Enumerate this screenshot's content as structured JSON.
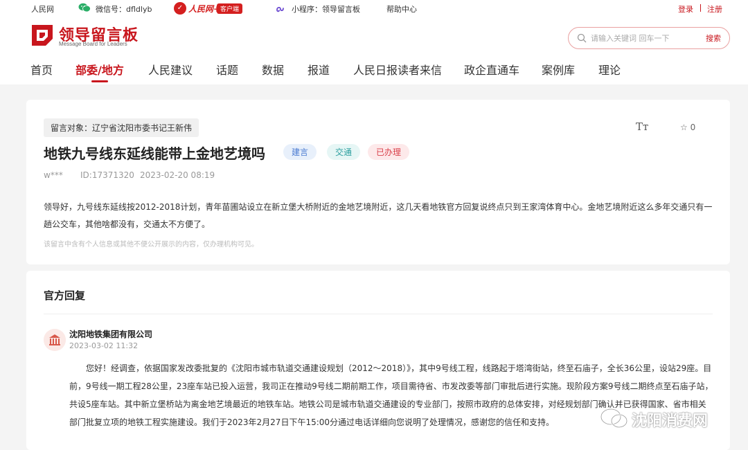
{
  "topbar": {
    "site_name": "人民网",
    "wechat_label": "微信号：dfldlyb",
    "rmw_brand": "人民网+",
    "client_badge": "客户端",
    "mini_program": "小程序：领导留言板",
    "help": "帮助中心",
    "login": "登录",
    "register": "注册"
  },
  "header": {
    "logo_title": "领导留言板",
    "logo_subtitle": "Message Board for Leaders",
    "search_placeholder": "请输入关键词 回车一下",
    "search_button": "搜索",
    "nav": [
      {
        "label": "首页"
      },
      {
        "label": "部委/地方"
      },
      {
        "label": "人民建议"
      },
      {
        "label": "话题"
      },
      {
        "label": "数据"
      },
      {
        "label": "报道"
      },
      {
        "label": "人民日报读者来信"
      },
      {
        "label": "政企直通车"
      },
      {
        "label": "案例库"
      },
      {
        "label": "理论"
      }
    ]
  },
  "message": {
    "target": "留言对象：辽宁省沈阳市委书记王新伟",
    "font_icon": "Tт",
    "favorite_count": "☆ 0",
    "title": "地铁九号线东延线能带上金地艺境吗",
    "tags": [
      "建言",
      "交通",
      "已办理"
    ],
    "author": "w***",
    "id": "ID:17371320",
    "datetime": "2023-02-20 08:19",
    "body": "领导好，九号线东延线按2012-2018计划，青年苗圃站设立在新立堡大桥附近的金地艺境附近，这几天看地铁官方回复说终点只到王家湾体育中心。金地艺境附近这么多年交通只有一趟公交车，其他啥都没有，交通太不方便了。",
    "privacy_note": "该留言中含有个人信息或其他不便公开展示的内容，仅办理机构可见。"
  },
  "reply": {
    "heading": "官方回复",
    "org_name": "沈阳地铁集团有限公司",
    "time": "2023-03-02 11:32",
    "text": "您好！经调查，依据国家发改委批复的《沈阳市城市轨道交通建设规划（2012～2018）》，其中9号线工程，线路起于塔湾街站，终至石庙子，全长36公里，设站29座。目前，9号线一期工程28公里，23座车站已投入运营，我司正在推动9号线二期前期工作，项目需待省、市发改委等部门审批后进行实施。现阶段方案9号线二期终点至石庙子站，共设5座车站。其中新立堡桥站为离金地艺境最近的地铁车站。地铁公司是城市轨道交通建设的专业部门，按照市政府的总体安排，对经规划部门确认并已获得国家、省市相关部门批复立项的地铁工程实施建设。我们于2023年2月27日下午15:00分通过电话详细向您说明了处理情况，感谢您的信任和支持。"
  },
  "watermark": {
    "text": "沈阳消费网"
  },
  "colors": {
    "brand_red": "#c8161d",
    "tag_blue": "#4b7bd1",
    "tag_teal": "#2ea0a0",
    "tag_red": "#d9414b"
  },
  "icons": [
    "wechat-icon",
    "rmw-logo-icon",
    "mini-program-icon",
    "search-icon",
    "font-size-icon",
    "star-icon",
    "government-building-icon",
    "wechat-watermark-icon"
  ]
}
